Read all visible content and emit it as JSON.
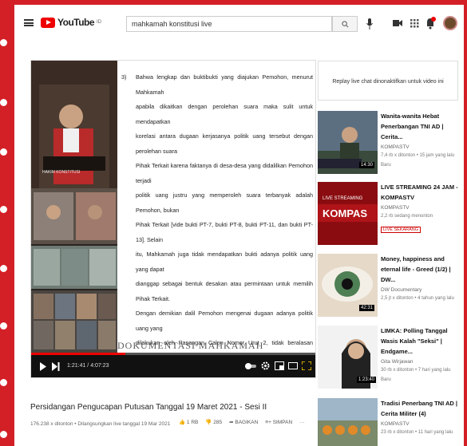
{
  "search": {
    "query": "mahkamah konstitusi live"
  },
  "logo": {
    "text": "YouTube",
    "sup": "ID"
  },
  "doc": {
    "number": "3)",
    "lines": [
      "Bahwa lengkap dan buktibukti yang diajukan Pemohon, menurut Mahkamah",
      "apabila dikaitkan dengan perolehan suara maka sulit untuk mendapatkan",
      "korelasi antara dugaan kerjasa­nya politik uang tersebut dengan perolehan suara",
      "Pihak Terkait karena faktanya di desa-desa yang didalilkan Pemohon terjadi",
      "politik uang justru yang memperoleh suara terbanyak adalah Pemohon, bukan",
      "Pihak Terkait [vide bukti PT-7, bukti PT-8, bukti PT-11, dan bukti PT-13]. Selain",
      "itu, Mahkamah juga tidak mendapatkan bukti adanya politik uang yang dapat",
      "dianggap sebagai bentuk desakan atau permintaan untuk memilih Pihak Terkait.",
      "Dengan demikian dalil Pemohon mengenai dugaan adanya politik uang yang",
      "dilakukan oleh Pasangan Calon Nomor Urut 2, tidak beralasan menurut hukum."
    ],
    "watermark": "DOKUMENTASI MAHKAMAH KONSTITUSI"
  },
  "player": {
    "time": "1:21:41 / 4:07:23",
    "progress": 0.33,
    "nameplate": "HAKIM KONSTITUSI"
  },
  "video": {
    "title": "Persidangan Pengucapan Putusan Tanggal 19 Maret 2021 - Sesi II",
    "meta": "176.238 x ditonton • Dilangsungkan live tanggal 19 Mar 2021",
    "likes": "1 RB",
    "dislikes": "285",
    "share": "BAGIKAN",
    "save": "SIMPAN"
  },
  "chat": {
    "text": "Replay live chat dinonaktifkan untuk video ini"
  },
  "recs": [
    {
      "title": "Wanita-wanita Hebat Penerbangan TNI AD | Cerita...",
      "channel": "KOMPASTV",
      "meta": "7,4 rb x ditonton • 15 jam yang lalu",
      "extra": "Baru",
      "duration": "14:30"
    },
    {
      "title": "LIVE STREAMING 24 JAM - KOMPASTV",
      "channel": "KOMPASTV",
      "meta": "2,2 rb sedang menonton",
      "extra": "LIVE SEKARANG",
      "duration": ""
    },
    {
      "title": "Money, happiness and eternal life - Greed (1/2) | DW...",
      "channel": "DW Documentary",
      "meta": "2,5 jt x ditonton • 4 tahun yang lalu",
      "extra": "",
      "duration": "42:31"
    },
    {
      "title": "LIMKA: Polling Tanggal Wasis Kalah \"Seksi\" | Endgame...",
      "channel": "Gita Wirjawan",
      "meta": "30 rb x ditonton • 7 hari yang lalu",
      "extra": "Baru",
      "duration": "1:23:40"
    },
    {
      "title": "Tradisi Penerbang TNI AD | Cerita Militer (4)",
      "channel": "KOMPASTV",
      "meta": "23 rb x ditonton • 11 hari yang lalu",
      "extra": "",
      "duration": ""
    }
  ],
  "colors": {
    "frame": "#d32027",
    "accent": "#e00000"
  }
}
